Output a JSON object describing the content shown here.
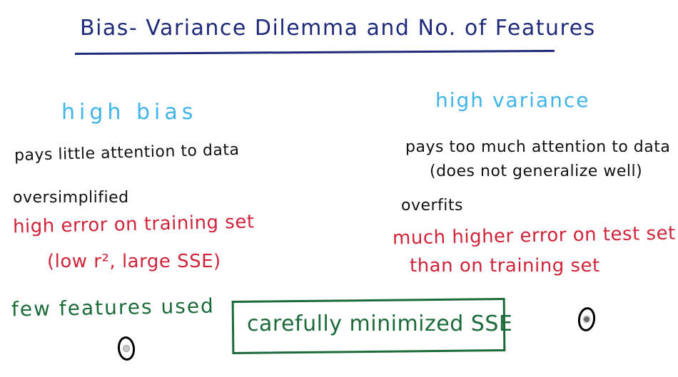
{
  "title": "Bias- Variance Dilemma and No. of Features",
  "left": {
    "heading": "high bias",
    "line1": "pays little attention to data",
    "line2": "oversimplified",
    "line3": "high error on training set",
    "line4": "(low r², large SSE)",
    "line5": "few features used"
  },
  "right": {
    "heading": "high variance",
    "line1": "pays too much attention to data",
    "line2": "(does not generalize well)",
    "line3": "overfits",
    "line4": "much higher error on test set",
    "line5": "than on training set"
  },
  "center_box": "carefully minimized SSE",
  "colors": {
    "title": "#1f2a7a",
    "heading": "#3fb4ea",
    "text": "#111111",
    "error": "#d0243a",
    "green": "#1b6b3a"
  },
  "options": {
    "left_selected": false,
    "right_selected": true
  }
}
